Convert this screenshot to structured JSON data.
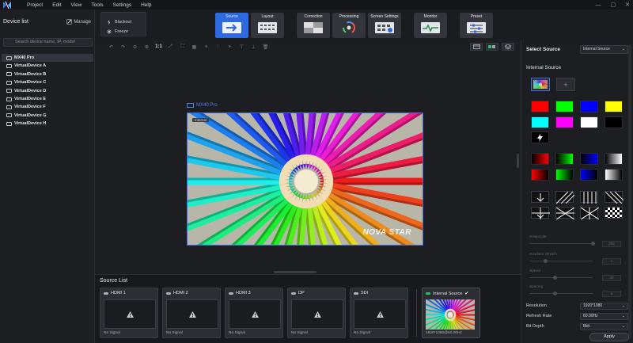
{
  "menu": {
    "items": [
      "Project",
      "Edit",
      "View",
      "Tools",
      "Settings",
      "Help"
    ],
    "window_controls": [
      "—",
      "▢",
      "✕"
    ]
  },
  "device_panel": {
    "title": "Device list",
    "manage_label": "Manage",
    "search_placeholder": "Search device name, IP, model",
    "devices": [
      {
        "label": "MX40 Pro",
        "selected": true
      },
      {
        "label": "VirtualDevice A",
        "selected": false
      },
      {
        "label": "VirtualDevice B",
        "selected": false
      },
      {
        "label": "VirtualDevice C",
        "selected": false
      },
      {
        "label": "VirtualDevice D",
        "selected": false
      },
      {
        "label": "VirtualDevice E",
        "selected": false
      },
      {
        "label": "VirtualDevice F",
        "selected": false
      },
      {
        "label": "VirtualDevice G",
        "selected": false
      },
      {
        "label": "VirtualDevice H",
        "selected": false
      }
    ]
  },
  "quick_actions": {
    "blackout": "Blackout",
    "freeze": "Freeze"
  },
  "toolbar": {
    "buttons": [
      {
        "label": "Source",
        "active": true
      },
      {
        "label": "Layout",
        "active": false
      },
      {
        "label": "Correction",
        "active": false
      },
      {
        "label": "Processing",
        "active": false
      },
      {
        "label": "Screen Settings",
        "active": false
      },
      {
        "label": "Monitor",
        "active": false
      },
      {
        "label": "Preset",
        "active": false
      }
    ]
  },
  "canvas": {
    "zoom_label": "1:1",
    "screen_name": "MX40 Pro",
    "internal_tag": "Internal",
    "watermark": "NOVA STAR"
  },
  "source_list": {
    "title": "Source List",
    "sources": [
      {
        "name": "HDMI 1",
        "status": "No Signal"
      },
      {
        "name": "HDMI 2",
        "status": "No Signal"
      },
      {
        "name": "HDMI 3",
        "status": "No Signal"
      },
      {
        "name": "DP",
        "status": "No Signal"
      },
      {
        "name": "SDI",
        "status": "No Signal"
      }
    ],
    "internal": {
      "name": "Internal Source",
      "status": "1920*1080@60.00Hz"
    }
  },
  "right_panel": {
    "select_source_label": "Select Source",
    "source_dropdown": "Internal Source",
    "internal_source_title": "Internal Source",
    "solid_colors": [
      "#ff0000",
      "#00ff00",
      "#0000ff",
      "#ffff00",
      "#00ffff",
      "#ff00ff",
      "#ffffff",
      "#000000"
    ],
    "sliders": [
      {
        "label": "Grayscale",
        "value": "255"
      },
      {
        "label": "Gradient Stretch",
        "value": "1"
      },
      {
        "label": "Speed",
        "value": "30"
      },
      {
        "label": "Spacing",
        "value": "5"
      }
    ],
    "resolution_label": "Resolution",
    "resolution_value": "1920*1080",
    "refresh_label": "Refresh Rate",
    "refresh_value": "60.00Hz",
    "bitdepth_label": "Bit Depth",
    "bitdepth_value": "8bit",
    "apply_label": "Apply"
  }
}
